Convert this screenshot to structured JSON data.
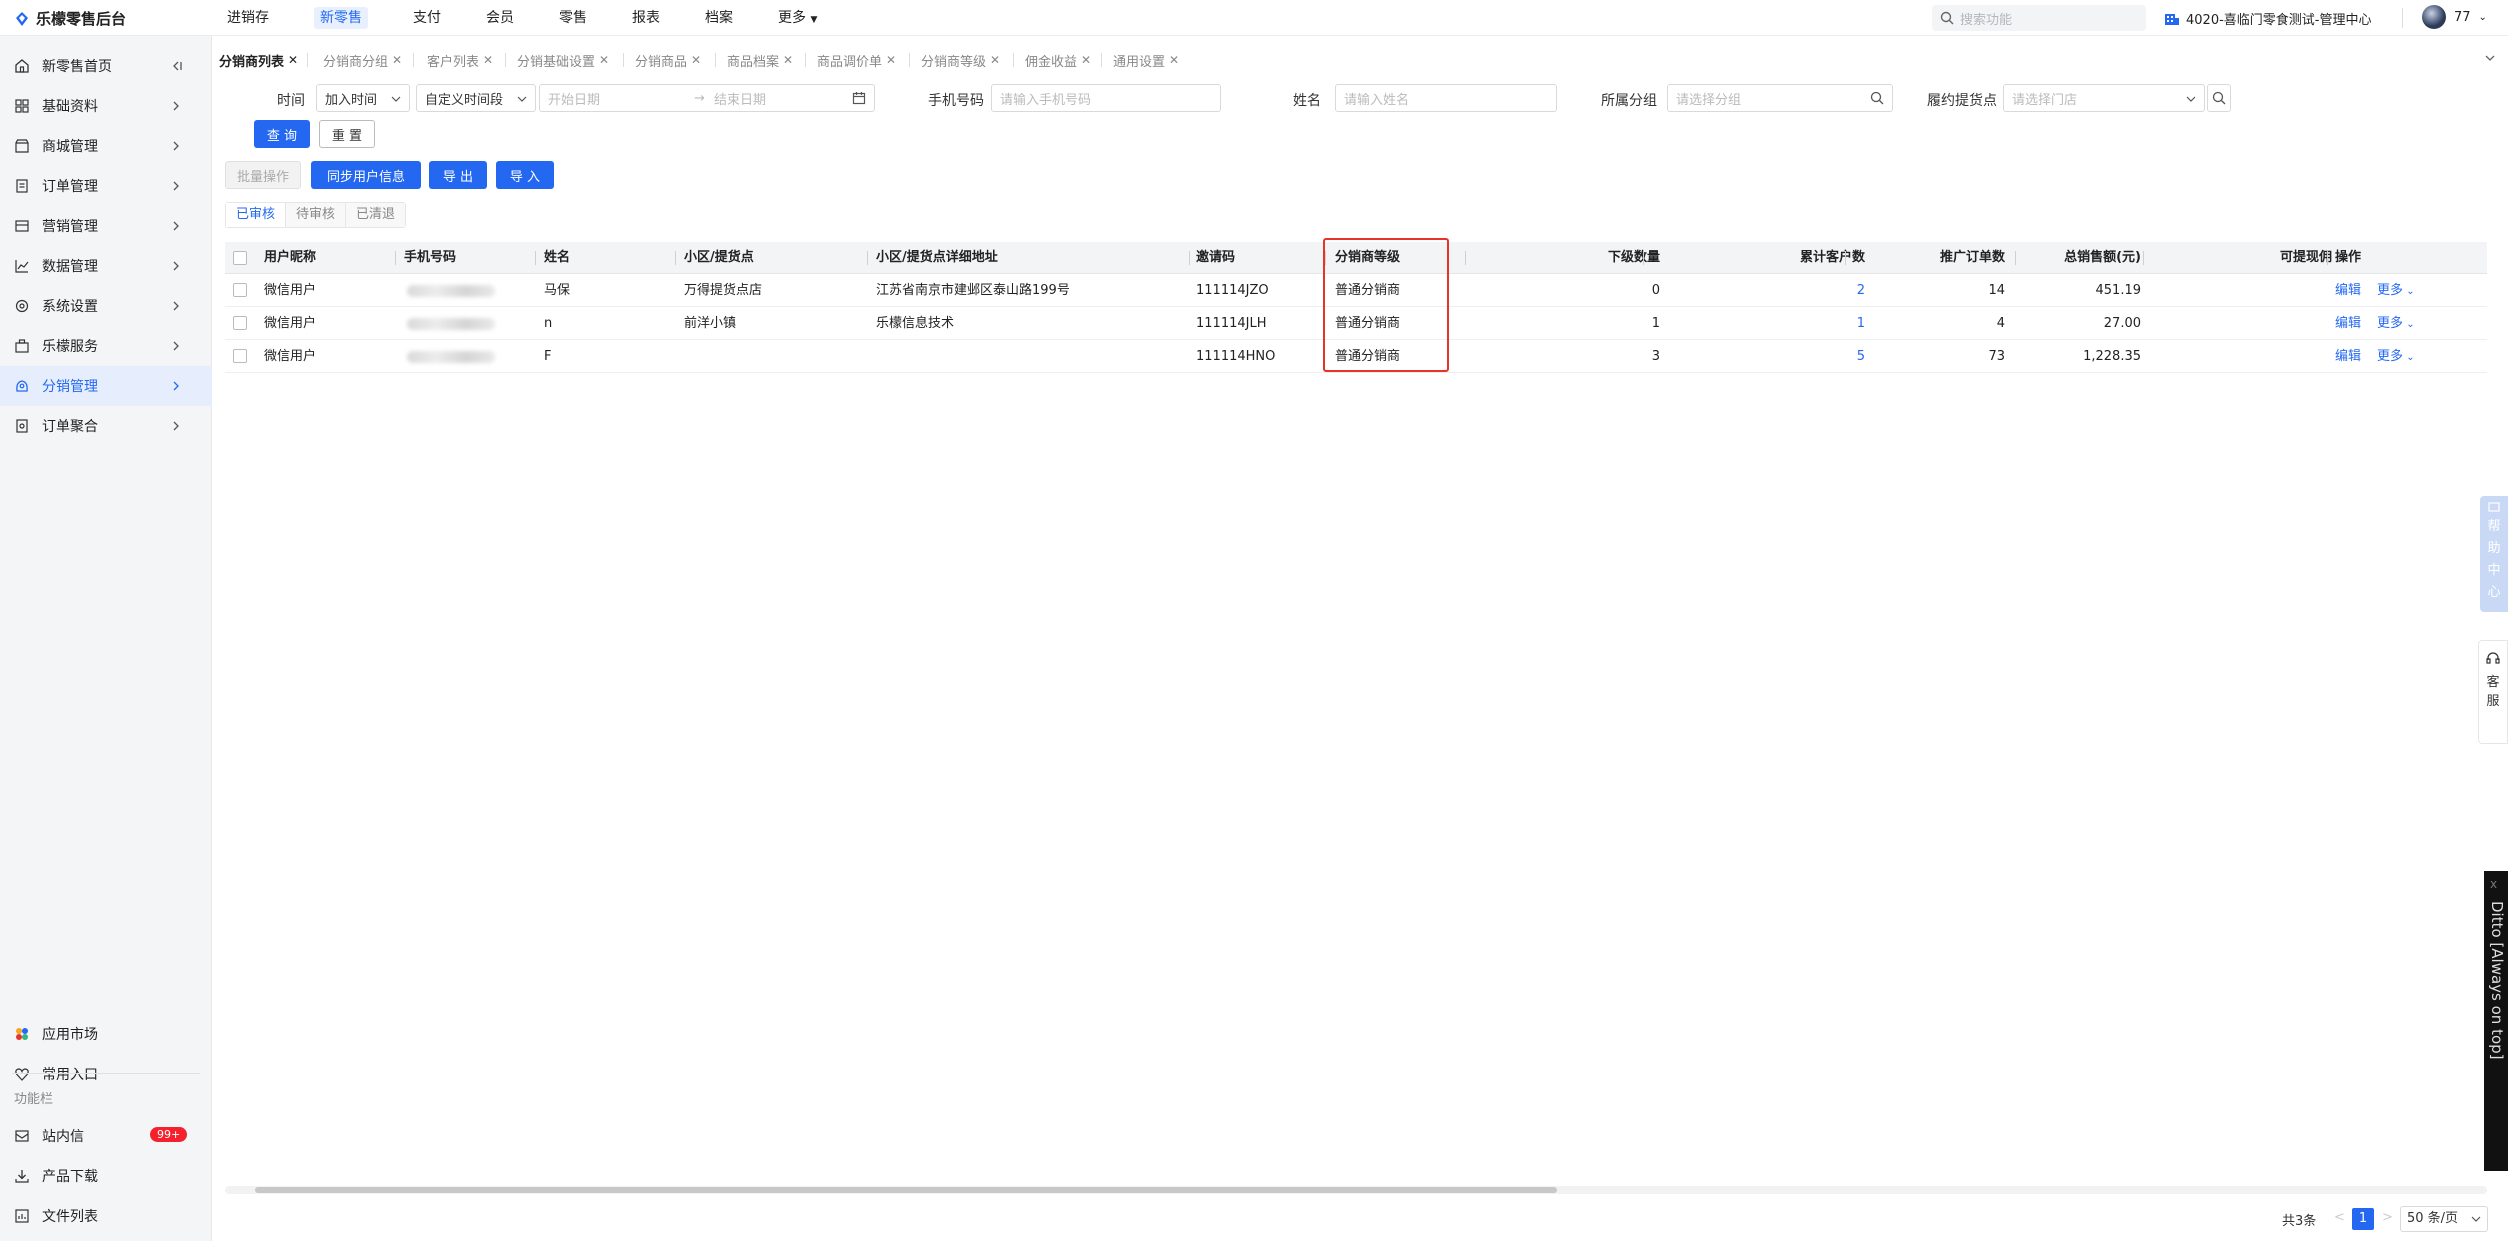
{
  "app": {
    "title": "乐檬零售后台"
  },
  "topnav": [
    {
      "label": "进销存",
      "active": false
    },
    {
      "label": "新零售",
      "active": true
    },
    {
      "label": "支付",
      "active": false
    },
    {
      "label": "会员",
      "active": false
    },
    {
      "label": "零售",
      "active": false
    },
    {
      "label": "报表",
      "active": false
    },
    {
      "label": "档案",
      "active": false
    },
    {
      "label": "更多",
      "active": false
    }
  ],
  "search": {
    "placeholder": "搜索功能"
  },
  "store": {
    "name": "4020-喜临门零食测试-管理中心"
  },
  "user": {
    "name": "77"
  },
  "sidebar": {
    "items": [
      {
        "label": "新零售首页",
        "icon": "home-icon"
      },
      {
        "label": "基础资料",
        "icon": "grid-icon"
      },
      {
        "label": "商城管理",
        "icon": "shop-icon"
      },
      {
        "label": "订单管理",
        "icon": "order-icon"
      },
      {
        "label": "营销管理",
        "icon": "marketing-icon"
      },
      {
        "label": "数据管理",
        "icon": "chart-icon"
      },
      {
        "label": "系统设置",
        "icon": "settings-icon"
      },
      {
        "label": "乐檬服务",
        "icon": "service-icon"
      },
      {
        "label": "分销管理",
        "icon": "distribution-icon",
        "active": true
      },
      {
        "label": "订单聚合",
        "icon": "aggregate-icon"
      }
    ],
    "bottom": {
      "app_market": "应用市场",
      "common_entry": "常用入口",
      "function_bar": "功能栏",
      "inbox": "站内信",
      "inbox_badge": "99+",
      "download": "产品下载",
      "file_list": "文件列表"
    }
  },
  "tabs": [
    {
      "label": "分销商列表",
      "active": true
    },
    {
      "label": "分销商分组"
    },
    {
      "label": "客户列表"
    },
    {
      "label": "分销基础设置"
    },
    {
      "label": "分销商品"
    },
    {
      "label": "商品档案"
    },
    {
      "label": "商品调价单"
    },
    {
      "label": "分销商等级"
    },
    {
      "label": "佣金收益"
    },
    {
      "label": "通用设置"
    }
  ],
  "filters": {
    "time_label": "时间",
    "time_type": "加入时间",
    "time_range": "自定义时间段",
    "start_placeholder": "开始日期",
    "range_arrow": "→",
    "end_placeholder": "结束日期",
    "phone_label": "手机号码",
    "phone_placeholder": "请输入手机号码",
    "name_label": "姓名",
    "name_placeholder": "请输入姓名",
    "group_label": "所属分组",
    "group_placeholder": "请选择分组",
    "pickup_label": "履约提货点",
    "pickup_placeholder": "请选择门店",
    "query": "查 询",
    "reset": "重 置"
  },
  "actions": {
    "batch": "批量操作",
    "sync": "同步用户信息",
    "export": "导 出",
    "import": "导 入"
  },
  "subtabs": [
    {
      "label": "已审核",
      "active": true
    },
    {
      "label": "待审核"
    },
    {
      "label": "已清退"
    }
  ],
  "table": {
    "columns": [
      "用户昵称",
      "手机号码",
      "姓名",
      "小区/提货点",
      "小区/提货点详细地址",
      "邀请码",
      "分销商等级",
      "下级数量",
      "累计客户数",
      "推广订单数",
      "总销售额(元)",
      "可提现佣",
      "操作"
    ],
    "rows": [
      {
        "nickname": "微信用户",
        "name": "马保",
        "pickup": "万得提货点店",
        "address": "江苏省南京市建邺区泰山路199号",
        "code": "111114JZO",
        "level": "普通分销商",
        "sub": "0",
        "customers": "2",
        "orders": "14",
        "sales": "451.19"
      },
      {
        "nickname": "微信用户",
        "name": "n",
        "pickup": "前洋小镇",
        "address": "乐檬信息技术",
        "code": "111114JLH",
        "level": "普通分销商",
        "sub": "1",
        "customers": "1",
        "orders": "4",
        "sales": "27.00"
      },
      {
        "nickname": "微信用户",
        "name": "F",
        "pickup": "",
        "address": "",
        "code": "111114HNO",
        "level": "普通分销商",
        "sub": "3",
        "customers": "5",
        "orders": "73",
        "sales": "1,228.35"
      }
    ],
    "edit": "编辑",
    "more": "更多"
  },
  "pagination": {
    "total": "共3条",
    "prev": "<",
    "current": "1",
    "next": ">",
    "page_size": "50 条/页"
  },
  "float": {
    "help": [
      "帮",
      "助",
      "中",
      "心"
    ],
    "cs": [
      "客",
      "服"
    ],
    "ditto": "Ditto [Always on top]",
    "ditto_close": "x"
  },
  "colors": {
    "primary": "#2468f2",
    "highlight": "#e8332d"
  }
}
